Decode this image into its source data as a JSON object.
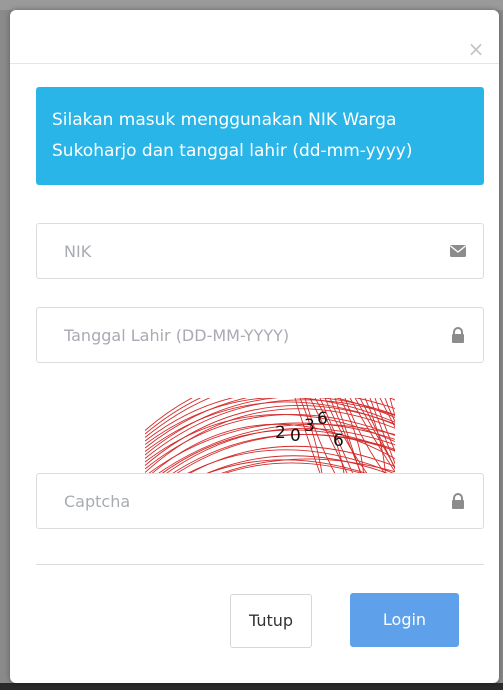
{
  "modal": {
    "close_symbol": "×",
    "info_text_line1": "Silakan masuk menggunakan NIK Warga",
    "info_text_line2": "Sukoharjo dan tanggal lahir (dd-mm-yyyy)",
    "nik": {
      "placeholder": "NIK",
      "value": "",
      "icon": "envelope-icon"
    },
    "birthdate": {
      "placeholder": "Tanggal Lahir (DD-MM-YYYY)",
      "value": "",
      "icon": "lock-icon"
    },
    "captcha_image": {
      "text": "20366"
    },
    "captcha": {
      "placeholder": "Captcha",
      "value": "",
      "icon": "lock-icon"
    },
    "buttons": {
      "close_label": "Tutup",
      "login_label": "Login"
    }
  },
  "colors": {
    "info_bg": "#29b5e8",
    "login_bg": "#5fa0ea",
    "captcha_lines": "#d42a2a"
  }
}
